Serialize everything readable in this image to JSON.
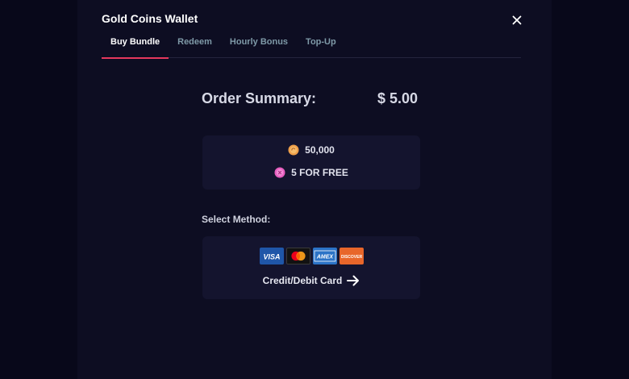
{
  "modal": {
    "title": "Gold Coins Wallet",
    "close_icon": "close-icon"
  },
  "tabs": [
    {
      "label": "Buy Bundle",
      "active": true
    },
    {
      "label": "Redeem",
      "active": false
    },
    {
      "label": "Hourly Bonus",
      "active": false
    },
    {
      "label": "Top-Up",
      "active": false
    }
  ],
  "summary": {
    "label": "Order Summary:",
    "price": "$ 5.00"
  },
  "bundle": {
    "gold_coins": "50,000",
    "gold_icon": "gold-coin-icon",
    "free_coins": "5 FOR FREE",
    "free_icon": "pink-coin-icon"
  },
  "payment": {
    "section_label": "Select Method:",
    "method_label": "Credit/Debit Card",
    "brands": [
      "VISA",
      "mastercard",
      "AMEX",
      "DISCOVER"
    ],
    "arrow_icon": "arrow-right-icon"
  },
  "colors": {
    "background": "#0b0b1d",
    "card": "#14142e",
    "accent": "#e5385d",
    "tab_inactive": "#7f9aa8",
    "gold": "#f0a04a",
    "pink": "#e85fc0"
  }
}
